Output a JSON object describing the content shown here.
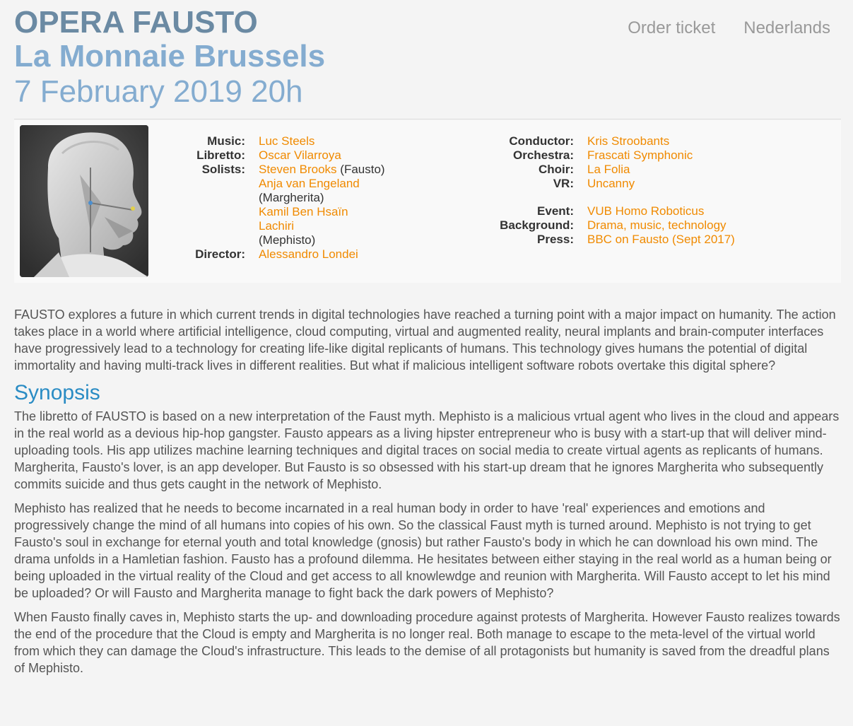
{
  "header": {
    "title": "OPERA FAUSTO",
    "venue": "La Monnaie Brussels",
    "date": "7 February 2019 20h"
  },
  "nav": {
    "order_ticket": "Order ticket",
    "language": "Nederlands"
  },
  "credits_left": {
    "music_label": "Music:",
    "music": "Luc Steels",
    "libretto_label": "Libretto:",
    "libretto": "Oscar Vilarroya",
    "solists_label": "Solists:",
    "solist1": "Steven Brooks",
    "solist1_role": "(Fausto)",
    "solist2": "Anja van Engeland",
    "solist2_role": "(Margherita)",
    "solist3": "Kamil Ben Hsaïn Lachiri",
    "solist3_role": "(Mephisto)",
    "director_label": "Director:",
    "director": "Alessandro Londei"
  },
  "credits_right": {
    "conductor_label": "Conductor:",
    "conductor": "Kris Stroobants",
    "orchestra_label": "Orchestra:",
    "orchestra": "Frascati Symphonic",
    "choir_label": "Choir:",
    "choir": "La Folia",
    "vr_label": "VR:",
    "vr": "Uncanny",
    "event_label": "Event:",
    "event": "VUB Homo Roboticus",
    "background_label": "Background:",
    "background": "Drama, music, technology",
    "press_label": "Press:",
    "press": "BBC on Fausto (Sept 2017)"
  },
  "intro": "FAUSTO explores a future in which current trends in digital technologies have reached a turning point with a major impact on humanity. The action takes place in a world where artificial intelligence, cloud computing, virtual and augmented reality, neural implants and brain-computer interfaces have progressively lead to a technology for creating life-like digital replicants of humans. This technology gives humans the potential of digital immortality and having multi-track lives in different realities. But what if malicious intelligent software robots overtake this digital sphere?",
  "synopsis": {
    "heading": "Synopsis",
    "p1": "The libretto of FAUSTO is based on a new interpretation of the Faust myth. Mephisto is a malicious vrtual agent who lives in the cloud and appears in the real world as a devious hip-hop gangster. Fausto appears as a living hipster entrepreneur who is busy with a start-up that will deliver mind-uploading tools. His app utilizes machine learning techniques and digital traces on social media to create virtual agents as replicants of humans. Margherita, Fausto's lover, is an app developer. But Fausto is so obsessed with his start-up dream that he ignores Margherita who subsequently commits suicide and thus gets caught in the network of Mephisto.",
    "p2": "Mephisto has realized that he needs to become incarnated in a real human body in order to have 'real' experiences and emotions and progressively change the mind of all humans into copies of his own. So the classical Faust myth is turned around. Mephisto is not trying to get Fausto's soul in exchange for eternal youth and total knowledge (gnosis) but rather Fausto's body in which he can download his own mind. The drama unfolds in a Hamletian fashion. Fausto has a profound dilemma. He hesitates between either staying in the real world as a human being or being uploaded in the virtual reality of the Cloud and get access to all knowlewdge and reunion with Margherita. Will Fausto accept to let his mind be uploaded? Or will Fausto and Margherita manage to fight back the dark powers of Mephisto?",
    "p3": "When Fausto finally caves in, Mephisto starts the up- and downloading procedure against protests of Margherita. However Fausto realizes towards the end of the procedure that the Cloud is empty and Margherita is no longer real. Both manage to escape to the meta-level of the virtual world from which they can damage the Cloud's infrastructure. This leads to the demise of all protagonists but humanity is saved from the dreadful plans of Mephisto."
  }
}
